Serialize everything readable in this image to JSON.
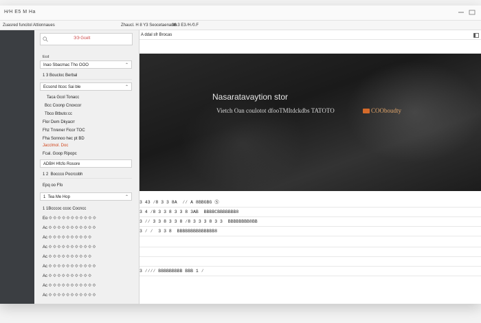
{
  "window": {
    "title": "H⁄H E5 M Ha"
  },
  "toolbar": {
    "left_label": "Zuasred funcitol Attionnaues",
    "mid_label": "Zhaucl. H 8 Y3 Seocetaenanth",
    "right_label": "36.3 E3 ⁄H ⁄0.F"
  },
  "sidebar": {
    "items": [
      {
        "label": "",
        "marker": "none"
      },
      {
        "label": "",
        "marker": "none"
      },
      {
        "label": "",
        "marker": "none"
      },
      {
        "label": "",
        "marker": "none"
      },
      {
        "label": "",
        "marker": "dot"
      },
      {
        "label": "",
        "marker": "none"
      },
      {
        "label": "",
        "marker": "green"
      },
      {
        "label": "",
        "marker": "square"
      },
      {
        "label": "",
        "marker": "square"
      },
      {
        "label": "",
        "marker": "none"
      },
      {
        "label": "",
        "marker": "dot"
      },
      {
        "label": "",
        "marker": "square"
      },
      {
        "label": "",
        "marker": "square"
      }
    ]
  },
  "panel": {
    "header_tab": "ЭЭ Gcelt",
    "group1_header": "Ecd",
    "group1_rows": [
      {
        "text": "I​na​o Sbacmac Tho OOO",
        "style": "boxed",
        "chev": "⌃"
      },
      {
        "text": "1 3 Boucloc Berbal",
        "style": "sep",
        "chev": ""
      },
      {
        "text": "Ecsond Itcoc Sai ble",
        "style": "boxed",
        "chev": "⌃"
      },
      {
        "text": "  Taca Gcol Tonacc",
        "style": "plain",
        "chev": ""
      },
      {
        "text": " Bcc Coonp Cnoxcor",
        "style": "plain",
        "chev": ""
      },
      {
        "text": " Tbco Btbuto:cc",
        "style": "plain",
        "chev": ""
      },
      {
        "text": "Flor Dem Dkyacrr",
        "style": "plain",
        "chev": ""
      },
      {
        "text": "Fhz Tnrener Ficor TOC",
        "style": "plain",
        "chev": ""
      },
      {
        "text": "Fha Sonnoo hec pt BD",
        "style": "plain",
        "chev": ""
      },
      {
        "text": "Jacclmol. Doc",
        "style": "orange",
        "chev": ""
      },
      {
        "text": "Fcal. Goop Ripopc",
        "style": "plain",
        "chev": ""
      }
    ],
    "group2_header": "ADBH Hfcfo Rosore",
    "group2_rows": [
      {
        "text": "1 2  Boccco Pocrcobh",
        "style": "sep",
        "chev": ""
      },
      {
        "text": "Epq oo Ffo",
        "style": "plain",
        "chev": ""
      },
      {
        "text": "1  Tea Me Hop",
        "style": "boxed",
        "chev": "⌃"
      },
      {
        "text": "1 1Bcccoc ccoc Cocncc",
        "style": "plain",
        "chev": ""
      },
      {
        "text": "Eo ⟐ ⟐ ⟐ ⟐ ⟐ ⟐ ⟐ ⟐ ⟐ ⟐ ⟐",
        "style": "plain",
        "chev": ""
      },
      {
        "text": "Ac ⟐ ⟐ ⟐ ⟐ ⟐ ⟐ ⟐ ⟐ ⟐ ⟐ ⟐",
        "style": "plain",
        "chev": ""
      },
      {
        "text": "Ac ⟐ ⟐ ⟐ ⟐ ⟐ ⟐ ⟐ ⟐ ⟐ ⟐",
        "style": "plain",
        "chev": ""
      },
      {
        "text": "Ac ⟐ ⟐ ⟐ ⟐ ⟐ ⟐ ⟐ ⟐ ⟐ ⟐ ⟐",
        "style": "plain",
        "chev": ""
      },
      {
        "text": "Ac ⟐ ⟐ ⟐ ⟐ ⟐ ⟐ ⟐ ⟐ ⟐ ⟐",
        "style": "plain",
        "chev": ""
      },
      {
        "text": "Ac ⟐ ⟐ ⟐ ⟐ ⟐ ⟐ ⟐ ⟐ ⟐ ⟐ ⟐",
        "style": "plain",
        "chev": ""
      },
      {
        "text": "Ac ⟐ ⟐ ⟐ ⟐ ⟐ ⟐ ⟐ ⟐ ⟐ ⟐",
        "style": "plain",
        "chev": ""
      },
      {
        "text": "Ac ⟐ ⟐ ⟐ ⟐ ⟐ ⟐ ⟐ ⟐ ⟐ ⟐ ⟐",
        "style": "plain",
        "chev": ""
      },
      {
        "text": "Ac ⟐ ⟐ ⟐ ⟐ ⟐ ⟐ ⟐ ⟐ ⟐ ⟐ ⟐",
        "style": "plain",
        "chev": ""
      }
    ]
  },
  "main": {
    "breadcrumb": "A ddal sfr Brocas",
    "hero_title": "Nasaratavaytion stor",
    "hero_subtitle": "Vietch Oan coulotot dfooTMItdckdbs TATOTO",
    "hero_badge_text": "COOboudty",
    "hero_badge_color": "#d46a2a",
    "data_rows": [
      "3 43 ⁄8 3 3 8A  ⁄⁄ A 8BBGBG Ⓢ",
      "3 4 ⁄8 3 3 8 3 3 8 3AB  BBBBCBBBBBBB8",
      "3 ⁄⁄ 3 3 8 3 3 8 ⁄8 3 3 3 8 3 3  BBBBBBBB8BB",
      "3 ⁄ ⁄  3 3 8  BBBBBBBBBBBBBB8",
      "",
      "",
      "",
      "3 ⁄⁄⁄⁄ BBBBBBBBB BBB 1 ⁄"
    ]
  },
  "colors": {
    "sidebar_bg": "#3b3e42",
    "accent_orange": "#d0451b",
    "accent_green": "#7bb35f"
  }
}
